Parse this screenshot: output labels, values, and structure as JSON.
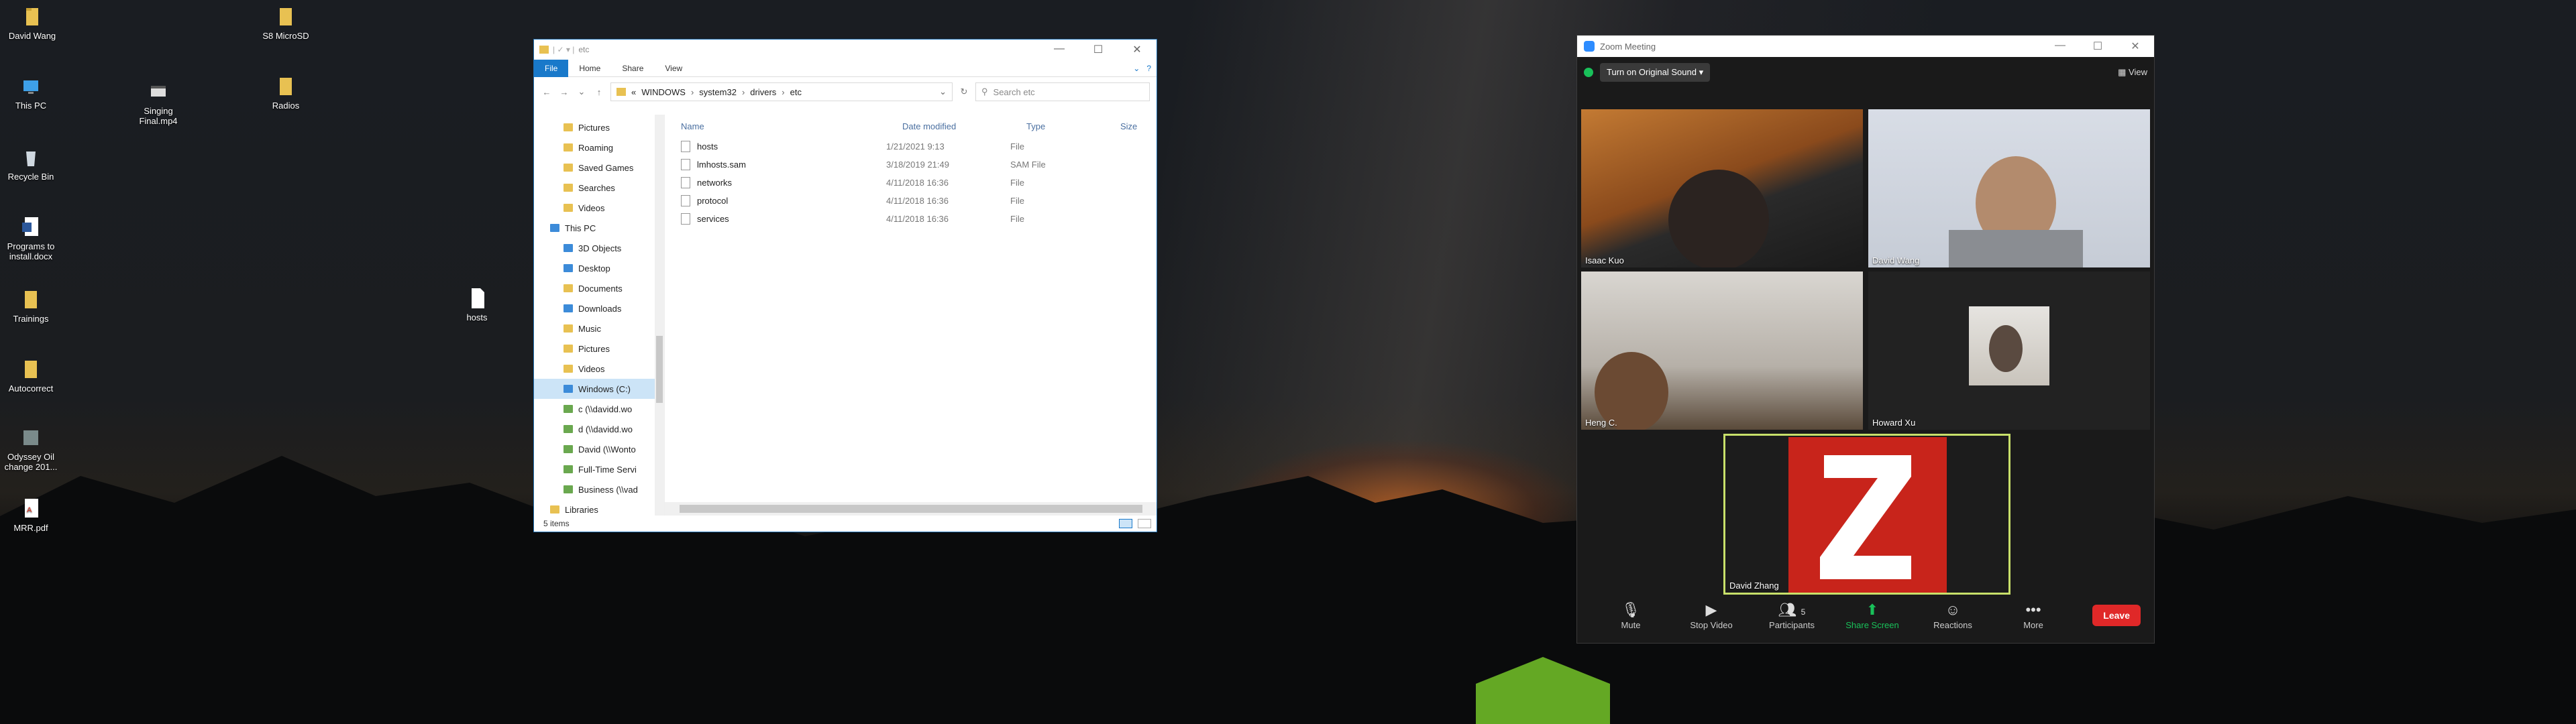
{
  "desktop_icons": [
    {
      "label": "David Wang",
      "icon": "folder-icon"
    },
    {
      "label": "This PC",
      "icon": "computer-icon"
    },
    {
      "label": "Recycle Bin",
      "icon": "recycle-bin-icon"
    },
    {
      "label": "Programs to install.docx",
      "icon": "word-doc-icon"
    },
    {
      "label": "Trainings",
      "icon": "folder-icon"
    },
    {
      "label": "Autocorrect",
      "icon": "folder-icon"
    },
    {
      "label": "Odyssey Oil change 201...",
      "icon": "image-file-icon"
    },
    {
      "label": "MRR.pdf",
      "icon": "pdf-icon"
    },
    {
      "label": "Singing Final.mp4",
      "icon": "video-file-icon"
    },
    {
      "label": "S8 MicroSD",
      "icon": "folder-icon"
    },
    {
      "label": "Radios",
      "icon": "folder-icon"
    },
    {
      "label": "hosts",
      "icon": "file-icon"
    }
  ],
  "explorer": {
    "title": "etc",
    "ribbon_tabs": [
      "File",
      "Home",
      "Share",
      "View"
    ],
    "address": [
      "WINDOWS",
      "system32",
      "drivers",
      "etc"
    ],
    "address_prefix": "«",
    "search_placeholder": "Search etc",
    "nav_items": [
      {
        "label": "Pictures",
        "level": 2,
        "icon": "folder"
      },
      {
        "label": "Roaming",
        "level": 2,
        "icon": "folder"
      },
      {
        "label": "Saved Games",
        "level": 2,
        "icon": "folder"
      },
      {
        "label": "Searches",
        "level": 2,
        "icon": "folder"
      },
      {
        "label": "Videos",
        "level": 2,
        "icon": "folder"
      },
      {
        "label": "This PC",
        "level": 1,
        "icon": "computer"
      },
      {
        "label": "3D Objects",
        "level": 2,
        "icon": "blue"
      },
      {
        "label": "Desktop",
        "level": 2,
        "icon": "blue"
      },
      {
        "label": "Documents",
        "level": 2,
        "icon": "folder"
      },
      {
        "label": "Downloads",
        "level": 2,
        "icon": "blue"
      },
      {
        "label": "Music",
        "level": 2,
        "icon": "folder"
      },
      {
        "label": "Pictures",
        "level": 2,
        "icon": "folder"
      },
      {
        "label": "Videos",
        "level": 2,
        "icon": "folder"
      },
      {
        "label": "Windows (C:)",
        "level": 2,
        "icon": "drive",
        "selected": true
      },
      {
        "label": "c (\\\\davidd.wo",
        "level": 2,
        "icon": "net"
      },
      {
        "label": "d (\\\\davidd.wo",
        "level": 2,
        "icon": "net"
      },
      {
        "label": "David (\\\\Wonto",
        "level": 2,
        "icon": "net"
      },
      {
        "label": "Full-Time Servi",
        "level": 2,
        "icon": "net"
      },
      {
        "label": "Business (\\\\vad",
        "level": 2,
        "icon": "net"
      },
      {
        "label": "Libraries",
        "level": 1,
        "icon": "folder"
      }
    ],
    "columns": [
      "Name",
      "Date modified",
      "Type",
      "Size"
    ],
    "files": [
      {
        "name": "hosts",
        "date": "1/21/2021 9:13",
        "type": "File"
      },
      {
        "name": "lmhosts.sam",
        "date": "3/18/2019 21:49",
        "type": "SAM File"
      },
      {
        "name": "networks",
        "date": "4/11/2018 16:36",
        "type": "File"
      },
      {
        "name": "protocol",
        "date": "4/11/2018 16:36",
        "type": "File"
      },
      {
        "name": "services",
        "date": "4/11/2018 16:36",
        "type": "File"
      }
    ],
    "status": "5 items"
  },
  "zoom": {
    "title": "Zoom Meeting",
    "original_sound": "Turn on Original Sound",
    "view_label": "View",
    "participants": [
      {
        "name": "Isaac Kuo"
      },
      {
        "name": "David Wang"
      },
      {
        "name": "Heng C."
      },
      {
        "name": "Howard Xu"
      },
      {
        "name": "David Zhang"
      }
    ],
    "participant_count": "5",
    "controls": {
      "mute": "Mute",
      "stop_video": "Stop Video",
      "participants": "Participants",
      "share_screen": "Share Screen",
      "reactions": "Reactions",
      "more": "More",
      "leave": "Leave"
    },
    "colors": {
      "share": "#19c15a",
      "leave": "#e02828",
      "active_speaker": "#c8e06a"
    }
  }
}
